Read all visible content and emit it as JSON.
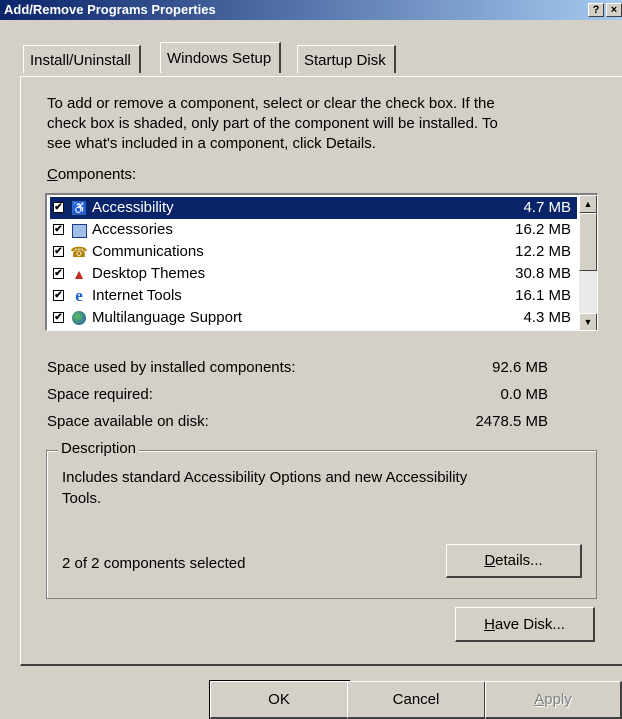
{
  "window": {
    "title": "Add/Remove Programs Properties",
    "help_label": "?",
    "close_label": "×"
  },
  "tabs": [
    {
      "label": "Install/Uninstall"
    },
    {
      "label": "Windows Setup"
    },
    {
      "label": "Startup Disk"
    }
  ],
  "instructions": {
    "line1": "To add or remove a component, select or clear the check box. If the",
    "line2": "check box is shaded, only part of the component will be installed. To",
    "line3": "see what's included in a component, click Details."
  },
  "components": {
    "label_first": "C",
    "label_rest": "omponents:",
    "items": [
      {
        "name": "Accessibility",
        "size": "4.7 MB",
        "checked": true,
        "icon": "accessibility-icon"
      },
      {
        "name": "Accessories",
        "size": "16.2 MB",
        "checked": true,
        "icon": "accessories-icon"
      },
      {
        "name": "Communications",
        "size": "12.2 MB",
        "checked": true,
        "icon": "communications-icon"
      },
      {
        "name": "Desktop Themes",
        "size": "30.8 MB",
        "checked": true,
        "icon": "desktop-themes-icon"
      },
      {
        "name": "Internet Tools",
        "size": "16.1 MB",
        "checked": true,
        "icon": "internet-explorer-icon"
      },
      {
        "name": "Multilanguage Support",
        "size": "4.3 MB",
        "checked": true,
        "icon": "globe-icon"
      }
    ]
  },
  "space": {
    "used_label": "Space used by installed components:",
    "used_value": "92.6 MB",
    "required_label": "Space required:",
    "required_value": "0.0 MB",
    "available_label": "Space available on disk:",
    "available_value": "2478.5 MB"
  },
  "description": {
    "legend": "Description",
    "line1": "Includes standard Accessibility Options and new Accessibility",
    "line2": "Tools.",
    "selected_text": "2 of 2 components selected",
    "details_first": "D",
    "details_rest": "etails..."
  },
  "have_disk": {
    "first": "H",
    "rest": "ave Disk..."
  },
  "footer": {
    "ok_label": "OK",
    "cancel_label": "Cancel",
    "apply_first": "A",
    "apply_rest": "pply"
  }
}
